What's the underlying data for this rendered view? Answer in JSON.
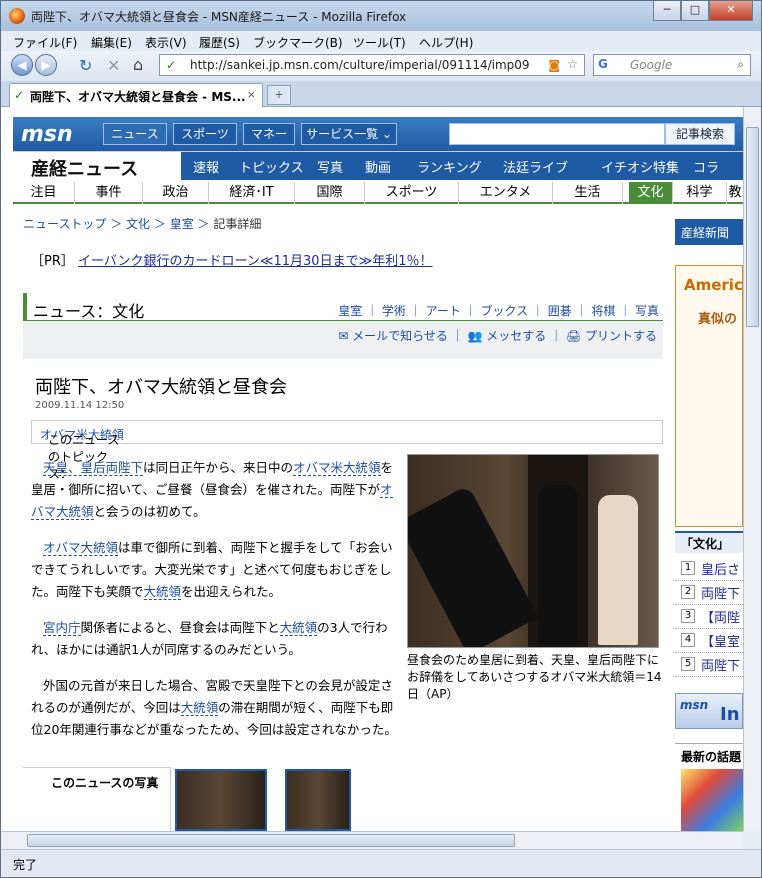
{
  "window": {
    "title": "両陛下、オバマ大統領と昼食会 - MSN産経ニュース - Mozilla Firefox",
    "minimize": "─",
    "maximize": "□",
    "close": "✕"
  },
  "menu": [
    "ファイル(F)",
    "編集(E)",
    "表示(V)",
    "履歴(S)",
    "ブックマーク(B)",
    "ツール(T)",
    "ヘルプ(H)"
  ],
  "nav": {
    "url": "http://sankei.jp.msn.com/culture/imperial/091114/imp09",
    "search_placeholder": "Google"
  },
  "tab": {
    "label": "両陛下、オバマ大統領と昼食会 - MS...",
    "close": "×",
    "new": "+"
  },
  "status": "完了",
  "msn": {
    "logo": "msn",
    "nav": [
      "ニュース",
      "スポーツ",
      "マネー",
      "サービス一覧 ⌄"
    ],
    "search_button": "記事検索"
  },
  "sankei": {
    "logo": "産経ニュース",
    "nav": [
      "速報",
      "トピックス",
      "写真",
      "動画",
      "ランキング",
      "法廷ライブ",
      "イチオシ特集",
      "コラム・"
    ]
  },
  "categories": [
    "注目",
    "事件",
    "政治",
    "経済･IT",
    "国際",
    "スポーツ",
    "エンタメ",
    "生活",
    "文化",
    "科学",
    "教"
  ],
  "active_category": "文化",
  "breadcrumb": {
    "items": [
      "ニューストップ",
      "文化",
      "皇室"
    ],
    "current": "記事詳細"
  },
  "pr": {
    "tag": "［PR］",
    "link": "イーバンク銀行のカードローン≪11月30日まで≫年利1％！"
  },
  "section": {
    "title": "ニュース：文化",
    "tabs": "皇室 ｜ 学術 ｜ アート ｜ ブックス ｜ 囲碁 ｜ 将棋 ｜ 写真",
    "actions": "✉ メールで知らせる ｜ 👥 メッセする ｜ 🖨 プリントする"
  },
  "article": {
    "title": "両陛下、オバマ大統領と昼食会",
    "date": "2009.11.14 12:50",
    "topic_label": "このニュースのトピックス：",
    "topic_link": "オバマ米大統領",
    "p1a": "天皇、皇后両陛下",
    "p1b": "は同日正午から、来日中の",
    "p1c": "オバマ米大統領",
    "p1d": "を皇居・御所に招いて、ご昼餐（昼食会）を催された。両陛下が",
    "p1e": "オバマ大統領",
    "p1f": "と会うのは初めて。",
    "p2a": "オバマ大統領",
    "p2b": "は車で御所に到着、両陛下と握手をして「お会いできてうれしいです。大変光栄です」と述べて何度もおじぎをした。両陛下も笑顔で",
    "p2c": "大統領",
    "p2d": "を出迎えられた。",
    "p3a": "宮内庁",
    "p3b": "関係者によると、昼食会は両陛下と",
    "p3c": "大統領",
    "p3d": "の3人で行われ、ほかには通訳1人が同席するのみだという。",
    "p4a": "外国の元首が来日した場合、宮殿で天皇陛下との会見が設定されるのが通例だが、今回は",
    "p4b": "大統領",
    "p4c": "の滞在期間が短く、両陛下も即位20年関連行事などが重なったため、今回は設定されなかった。",
    "caption": "昼食会のため皇居に到着、天皇、皇后両陛下にお辞儀をしてあいさつするオバマ米大統領＝14日（AP）",
    "photos_label": "このニュースの写真"
  },
  "right": {
    "sankei_label": "産経新聞",
    "ad1": "Americ",
    "ad2": "真似の",
    "list_head": "「文化」",
    "list": [
      "皇后さ",
      "両陛下",
      "【両陛",
      "【皇室",
      "両陛下"
    ],
    "msn_ad": "msn",
    "msn_ad2": "In",
    "latest": "最新の話題"
  }
}
